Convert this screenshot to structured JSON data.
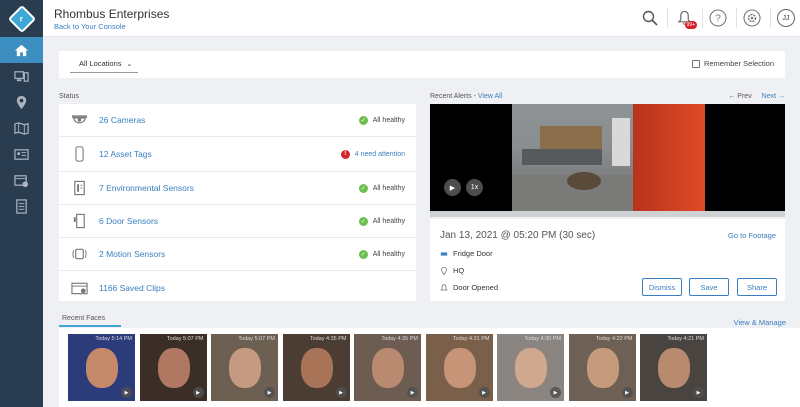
{
  "header": {
    "company": "Rhombus Enterprises",
    "back_link": "Back to Your Console",
    "notifications_badge": "99+",
    "avatar_initials": "JJ"
  },
  "sidebar": {
    "logo_letter": "r",
    "items": [
      {
        "icon": "home-icon",
        "active": true
      },
      {
        "icon": "devices-icon",
        "active": false
      },
      {
        "icon": "location-pin-icon",
        "active": false
      },
      {
        "icon": "map-icon",
        "active": false
      },
      {
        "icon": "id-card-icon",
        "active": false
      },
      {
        "icon": "calendar-settings-icon",
        "active": false
      },
      {
        "icon": "report-icon",
        "active": false
      }
    ]
  },
  "filters": {
    "location_value": "All Locations",
    "remember_label": "Remember Selection"
  },
  "status": {
    "title": "Status",
    "rows": [
      {
        "icon": "camera-dome-icon",
        "label": "26 Cameras",
        "state": "All healthy",
        "warn": false
      },
      {
        "icon": "asset-tag-icon",
        "label": "12 Asset Tags",
        "state": "4 need attention",
        "warn": true
      },
      {
        "icon": "environmental-sensor-icon",
        "label": "7 Environmental Sensors",
        "state": "All healthy",
        "warn": false
      },
      {
        "icon": "door-sensor-icon",
        "label": "6 Door Sensors",
        "state": "All healthy",
        "warn": false
      },
      {
        "icon": "motion-sensor-icon",
        "label": "2 Motion Sensors",
        "state": "All healthy",
        "warn": false
      },
      {
        "icon": "saved-clips-icon",
        "label": "1166 Saved Clips",
        "state": "",
        "warn": false
      }
    ]
  },
  "alerts": {
    "title": "Recent Alerts - ",
    "view_all": "View All",
    "prev": "← Prev",
    "next": "Next →",
    "speed": "1x",
    "time": "Jan 13, 2021 @ 05:20 PM (30 sec)",
    "goto": "Go to Footage",
    "device": "Fridge Door",
    "location": "HQ",
    "event": "Door Opened",
    "dismiss": "Dismiss",
    "save": "Save",
    "share": "Share"
  },
  "faces": {
    "title": "Recent Faces",
    "view_manage": "View & Manage",
    "items": [
      {
        "time": "Today 5:14 PM",
        "bg": "#2c3b7a",
        "skin": "#c58a6a"
      },
      {
        "time": "Today 5:07 PM",
        "bg": "#3a2e26",
        "skin": "#b07860"
      },
      {
        "time": "Today 5:07 PM",
        "bg": "#6d5f52",
        "skin": "#c49a80"
      },
      {
        "time": "Today 4:35 PM",
        "bg": "#4b3d33",
        "skin": "#a87357"
      },
      {
        "time": "Today 4:35 PM",
        "bg": "#6c5c52",
        "skin": "#b98a70"
      },
      {
        "time": "Today 4:31 PM",
        "bg": "#7a5f4a",
        "skin": "#c79478"
      },
      {
        "time": "Today 4:30 PM",
        "bg": "#8a8580",
        "skin": "#d0a88e"
      },
      {
        "time": "Today 4:22 PM",
        "bg": "#6e6054",
        "skin": "#c59a7d"
      },
      {
        "time": "Today 4:21 PM",
        "bg": "#4a4440",
        "skin": "#b88a6e"
      }
    ]
  }
}
